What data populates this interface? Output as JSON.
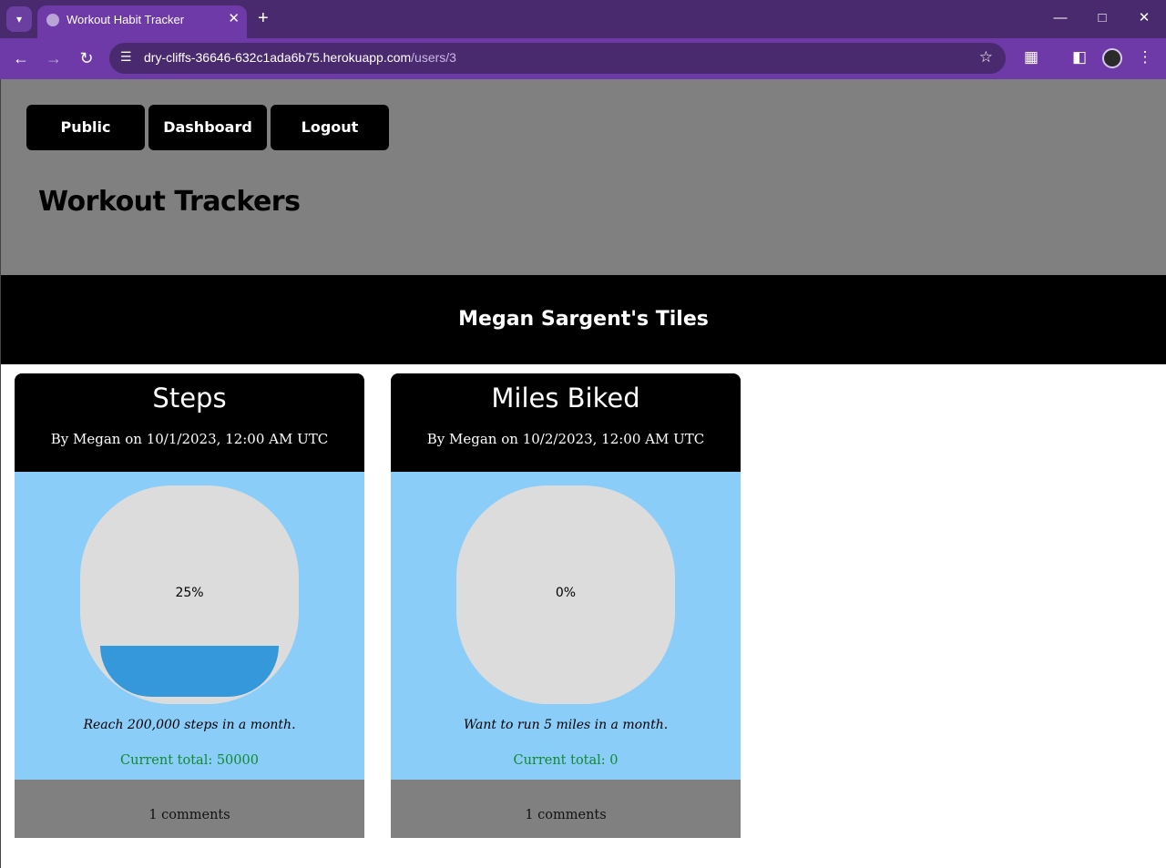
{
  "browser": {
    "tab_title": "Workout Habit Tracker",
    "new_tab_symbol": "+",
    "url_host": "dry-cliffs-36646-632c1ada6b75.herokuapp.com",
    "url_path": "/users/3",
    "icons": [
      "tab-search-icon",
      "globe-icon",
      "close-icon",
      "plus-icon",
      "minimize-icon",
      "maximize-icon",
      "window-close-icon",
      "back-icon",
      "forward-icon",
      "reload-icon",
      "site-info-icon",
      "star-icon",
      "extensions-icon",
      "side-panel-icon",
      "profile-icon",
      "menu-icon"
    ]
  },
  "nav": {
    "public": "Public",
    "dashboard": "Dashboard",
    "logout": "Logout"
  },
  "site_title": "Workout Trackers",
  "banner_title": "Megan Sargent's Tiles",
  "tiles": [
    {
      "title": "Steps",
      "byline": "By Megan on 10/1/2023, 12:00 AM UTC",
      "progress_label": "25%",
      "progress_fraction": 0.25,
      "goal": "Reach 200,000 steps in a month.",
      "current_total": "Current total: 50000",
      "comments": "1 comments"
    },
    {
      "title": "Miles Biked",
      "byline": "By Megan on 10/2/2023, 12:00 AM UTC",
      "progress_label": "0%",
      "progress_fraction": 0,
      "goal": "Want to run 5 miles in a month.",
      "current_total": "Current total: 0",
      "comments": "1 comments"
    }
  ],
  "colors": {
    "browser_dark": "#4a2a6e",
    "browser_accent": "#6d3aa8",
    "header_gray": "#808080",
    "tile_body_blue": "#8acdf8",
    "gauge_fill": "#3498db",
    "total_green": "#118a2c"
  }
}
